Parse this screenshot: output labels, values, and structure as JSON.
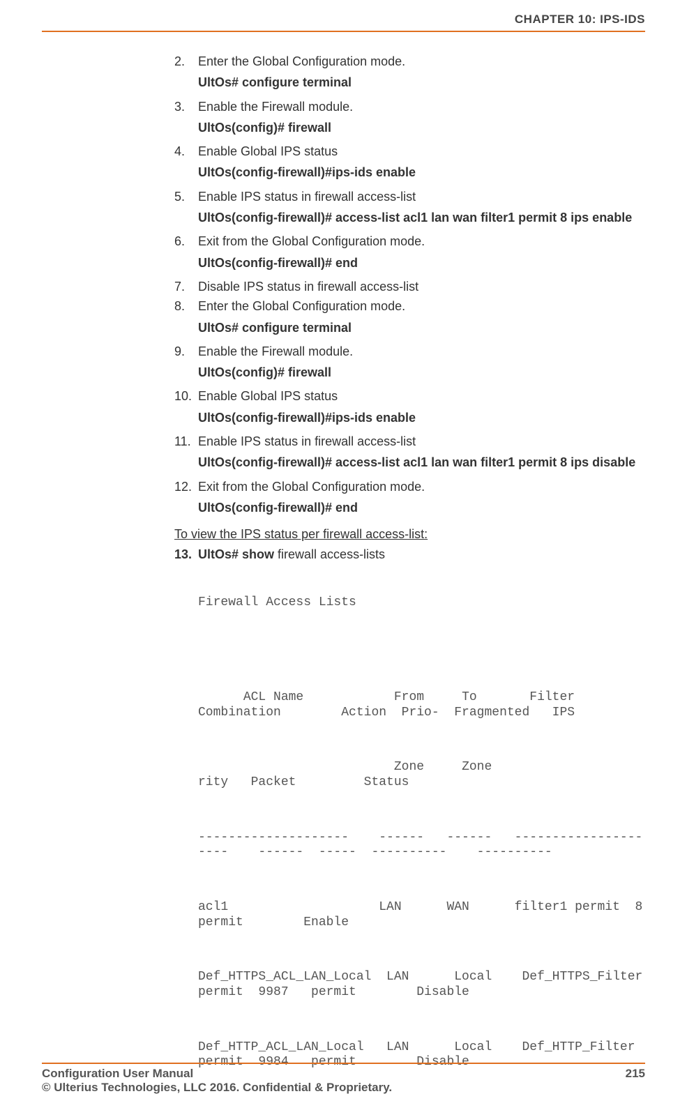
{
  "header": {
    "chapter": "CHAPTER 10: IPS-IDS"
  },
  "steps": {
    "s2": {
      "num": "2.",
      "text": "Enter the Global Configuration mode.",
      "cmd": "UltOs# configure terminal"
    },
    "s3": {
      "num": "3.",
      "text": "Enable the Firewall module.",
      "cmd": "UltOs(config)# firewall"
    },
    "s4": {
      "num": "4.",
      "text": "Enable Global IPS status",
      "cmd": "UltOs(config-firewall)#ips-ids enable"
    },
    "s5": {
      "num": "5.",
      "text": "Enable IPS status in firewall access-list",
      "cmd": "UltOs(config-firewall)# access-list acl1 lan wan filter1 permit 8 ips enable"
    },
    "s6": {
      "num": "6.",
      "text": "Exit from the Global Configuration mode.",
      "cmd": "UltOs(config-firewall)# end"
    },
    "s7": {
      "num": "7.",
      "text": "Disable IPS status in firewall access-list"
    },
    "s8": {
      "num": "8.",
      "text": "Enter the Global Configuration mode.",
      "cmd": "UltOs# configure terminal"
    },
    "s9": {
      "num": "9.",
      "text": "Enable the Firewall module.",
      "cmd": "UltOs(config)# firewall"
    },
    "s10": {
      "num": "10.",
      "text": "Enable Global IPS status",
      "cmd": "UltOs(config-firewall)#ips-ids enable"
    },
    "s11": {
      "num": "11.",
      "text": "Enable IPS status in firewall access-list",
      "cmd": "UltOs(config-firewall)# access-list acl1 lan wan filter1 permit 8 ips disable"
    },
    "s12": {
      "num": "12.",
      "text": "Exit from the Global Configuration mode.",
      "cmd": "UltOs(config-firewall)# end"
    }
  },
  "view_heading": "To view the IPS status per firewall access-list:",
  "s13": {
    "num": "13.",
    "prefix": "UltOs# show",
    "suffix": " firewall access-lists"
  },
  "output": {
    "l1": "Firewall Access Lists",
    "l2": "      ACL Name            From     To       Filter Combination        Action  Prio-  Fragmented   IPS",
    "l3": "                          Zone     Zone                               rity   Packet         Status",
    "l4": "--------------------    ------   ------   ---------------------    ------  -----  ----------    ----------",
    "l5": "acl1                    LAN      WAN      filter1 permit  8      permit        Enable",
    "l6": "Def_HTTPS_ACL_LAN_Local  LAN      Local    Def_HTTPS_Filter          permit  9987   permit        Disable",
    "l7": "Def_HTTP_ACL_LAN_Local   LAN      Local    Def_HTTP_Filter           permit  9984   permit        Disable"
  },
  "footer": {
    "left": "Configuration User Manual",
    "right": "215",
    "sub": "© Ulterius Technologies, LLC 2016. Confidential & Proprietary."
  }
}
